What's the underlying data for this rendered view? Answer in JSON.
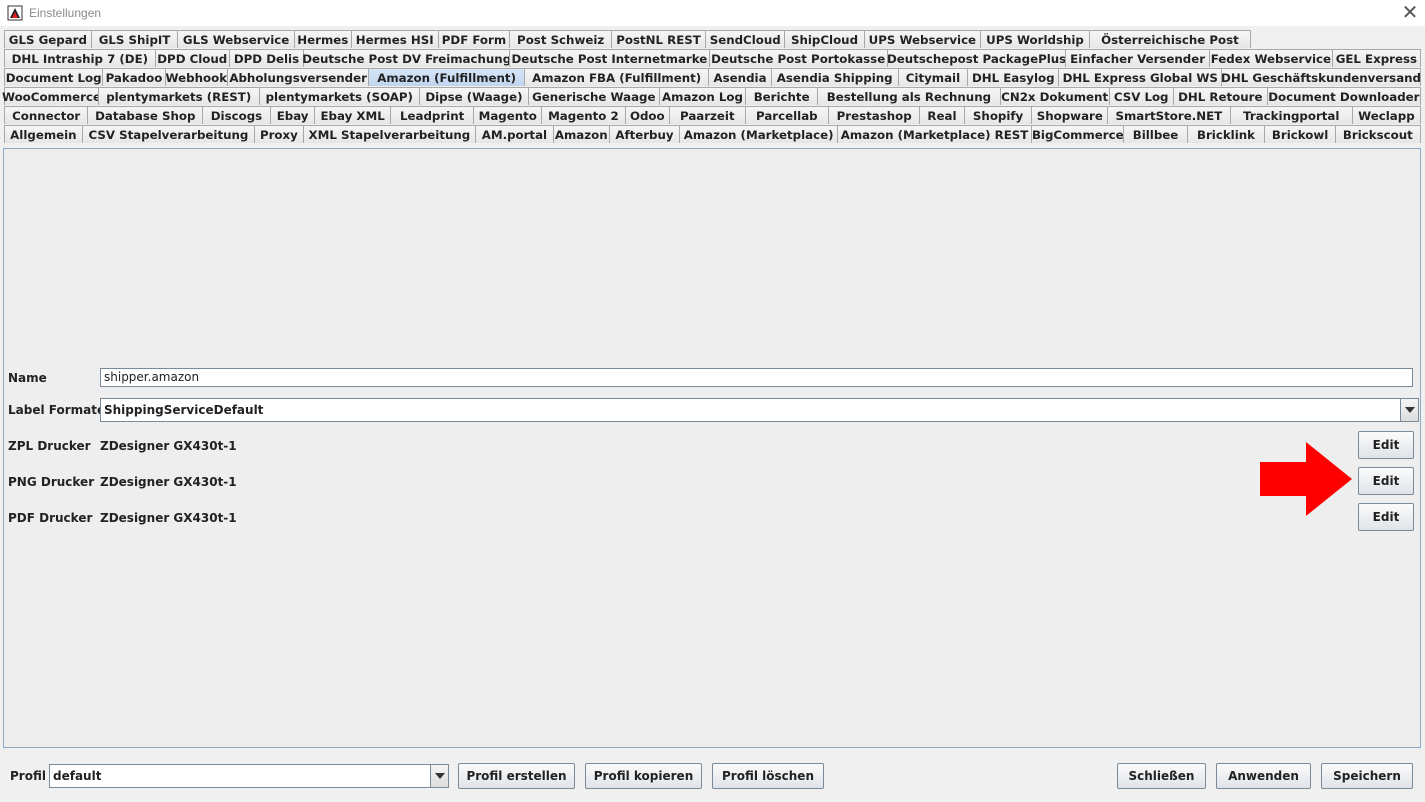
{
  "window": {
    "title": "Einstellungen",
    "close_glyph": "✕"
  },
  "tabs": {
    "rows": [
      [
        "GLS Gepard",
        "GLS ShipIT",
        "GLS Webservice",
        "Hermes",
        "Hermes HSI",
        "PDF Form",
        "Post Schweiz",
        "PostNL REST",
        "SendCloud",
        "ShipCloud",
        "UPS Webservice",
        "UPS Worldship",
        "Österreichische Post"
      ],
      [
        "DHL Intraship 7 (DE)",
        "DPD Cloud",
        "DPD Delis",
        "Deutsche Post DV Freimachung",
        "Deutsche Post Internetmarke",
        "Deutsche Post Portokasse",
        "Deutschepost PackagePlus",
        "Einfacher Versender",
        "Fedex Webservice",
        "GEL Express"
      ],
      [
        "Document Log",
        "Pakadoo",
        "Webhook",
        "Abholungsversender",
        "Amazon (Fulfillment)",
        "Amazon FBA (Fulfillment)",
        "Asendia",
        "Asendia Shipping",
        "Citymail",
        "DHL Easylog",
        "DHL Express Global WS",
        "DHL Geschäftskundenversand"
      ],
      [
        "WooCommerce",
        "plentymarkets (REST)",
        "plentymarkets (SOAP)",
        "Dipse (Waage)",
        "Generische Waage",
        "Amazon Log",
        "Berichte",
        "Bestellung als Rechnung",
        "CN2x Dokument",
        "CSV Log",
        "DHL Retoure",
        "Document Downloader"
      ],
      [
        "Connector",
        "Database Shop",
        "Discogs",
        "Ebay",
        "Ebay XML",
        "Leadprint",
        "Magento",
        "Magento 2",
        "Odoo",
        "Paarzeit",
        "Parcellab",
        "Prestashop",
        "Real",
        "Shopify",
        "Shopware",
        "SmartStore.NET",
        "Trackingportal",
        "Weclapp"
      ],
      [
        "Allgemein",
        "CSV Stapelverarbeitung",
        "Proxy",
        "XML Stapelverarbeitung",
        "AM.portal",
        "Amazon",
        "Afterbuy",
        "Amazon (Marketplace)",
        "Amazon (Marketplace) REST",
        "BigCommerce",
        "Billbee",
        "Bricklink",
        "Brickowl",
        "Brickscout"
      ]
    ],
    "selected": "Amazon (Fulfillment)"
  },
  "form": {
    "name_label": "Name",
    "name_value": "shipper.amazon",
    "label_format_label": "Label Formate",
    "label_format_value": "ShippingServiceDefault",
    "printers": [
      {
        "label": "ZPL Drucker",
        "value": "ZDesigner GX430t-1",
        "button": "Edit"
      },
      {
        "label": "PNG Drucker",
        "value": "ZDesigner GX430t-1",
        "button": "Edit"
      },
      {
        "label": "PDF Drucker",
        "value": "ZDesigner GX430t-1",
        "button": "Edit"
      }
    ],
    "arrow_color": "#ff0000"
  },
  "footer": {
    "profil_label": "Profil",
    "profil_value": "default",
    "create": "Profil erstellen",
    "copy": "Profil kopieren",
    "delete": "Profil löschen",
    "close": "Schließen",
    "apply": "Anwenden",
    "save": "Speichern"
  },
  "colors": {
    "selected_tab": "#c9dcf3",
    "panel_border": "#8da9c9"
  },
  "icons": {
    "app": "app-logo-icon",
    "dropdown": "chevron-down-icon"
  }
}
